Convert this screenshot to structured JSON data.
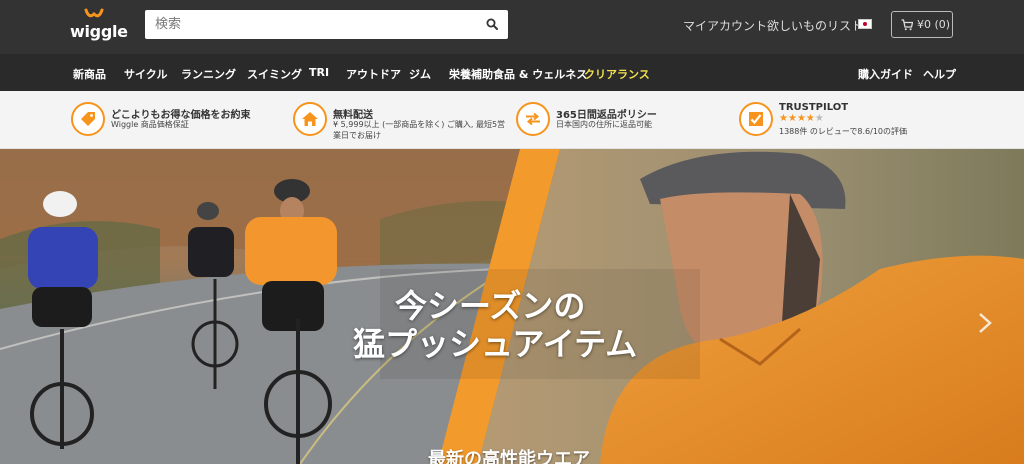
{
  "header": {
    "logo_text": "wiggle",
    "search": {
      "placeholder": "検索"
    },
    "links": {
      "account": "マイアカウント",
      "wishlist": "欲しいものリスト"
    },
    "cart": {
      "label": "¥0 (0)"
    }
  },
  "nav": {
    "items": [
      "新商品",
      "サイクル",
      "ランニング",
      "スイミング",
      "TRI",
      "アウトドア",
      "ジム",
      "栄養補助食品 & ウェルネス",
      "クリアランス"
    ],
    "right_items": [
      "購入ガイド",
      "ヘルプ"
    ]
  },
  "usp": [
    {
      "icon": "price-tag-icon",
      "title": "どこよりもお得な価格をお約束",
      "sub": "Wiggle 商品価格保証"
    },
    {
      "icon": "home-icon",
      "title": "無料配送",
      "sub": "¥ 5,999以上 (一部商品を除く) ご購入, 最短5営業日でお届け"
    },
    {
      "icon": "return-arrows-icon",
      "title": "365日間返品ポリシー",
      "sub": "日本国内の住所に返品可能"
    },
    {
      "icon": "trustpilot-icon",
      "title": "TRUSTPILOT",
      "rating": 4,
      "sub": "1388件 のレビューで8.6/10の評価"
    }
  ],
  "hero": {
    "title_line1": "今シーズンの",
    "title_line2": "猛プッシュアイテム",
    "subtitle": "最新の高性能ウエア"
  },
  "colors": {
    "accent": "#f7941d",
    "topbar": "#333333",
    "navbar": "#2a2a2a",
    "clearance": "#f4e04d"
  }
}
